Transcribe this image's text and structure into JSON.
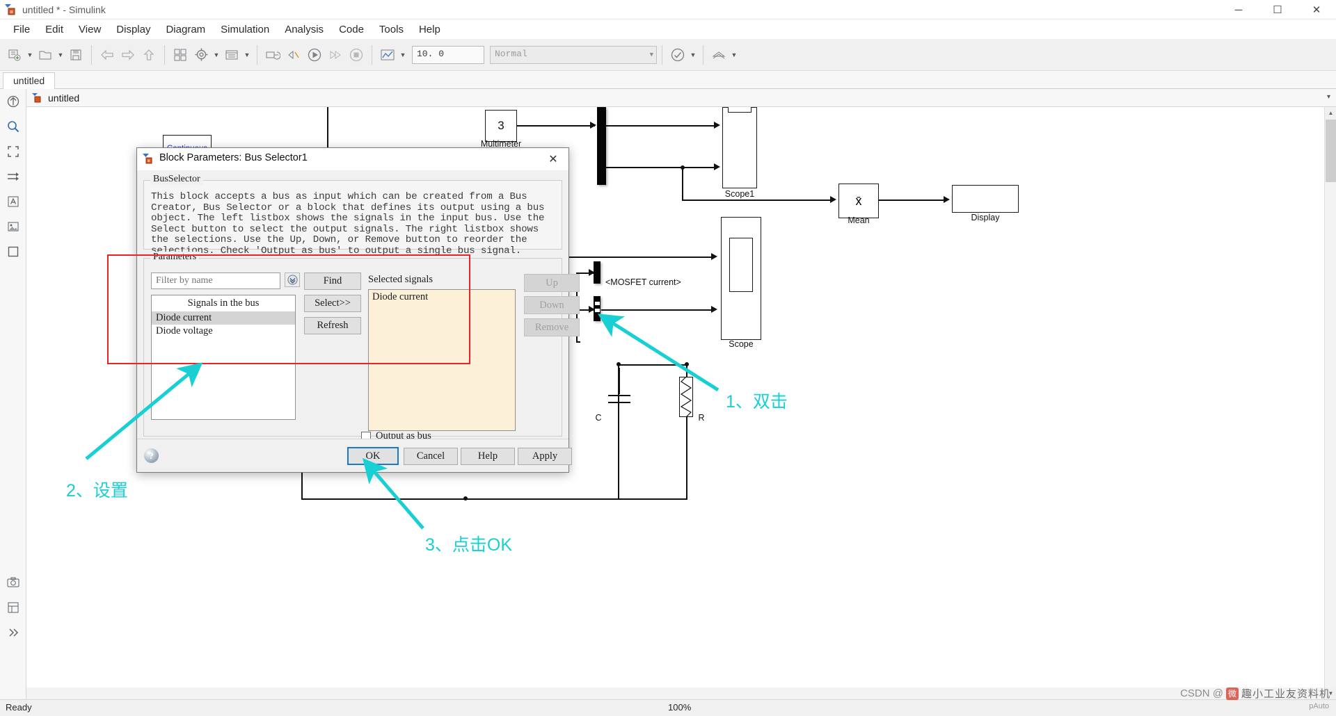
{
  "window": {
    "title": "untitled * - Simulink",
    "icon": "simulink-icon",
    "minimize": "─",
    "maximize": "☐",
    "close": "✕"
  },
  "menubar": {
    "items": [
      {
        "label": "File",
        "name": "menu-file"
      },
      {
        "label": "Edit",
        "name": "menu-edit"
      },
      {
        "label": "View",
        "name": "menu-view"
      },
      {
        "label": "Display",
        "name": "menu-display"
      },
      {
        "label": "Diagram",
        "name": "menu-diagram"
      },
      {
        "label": "Simulation",
        "name": "menu-simulation"
      },
      {
        "label": "Analysis",
        "name": "menu-analysis"
      },
      {
        "label": "Code",
        "name": "menu-code"
      },
      {
        "label": "Tools",
        "name": "menu-tools"
      },
      {
        "label": "Help",
        "name": "menu-help"
      }
    ]
  },
  "toolbar": {
    "stop_time": "10. 0",
    "sim_mode": "Normal"
  },
  "tabstrip": {
    "tab_label": "untitled"
  },
  "breadcrumb": {
    "label": "untitled"
  },
  "statusbar": {
    "status": "Ready",
    "zoom": "100%"
  },
  "canvas": {
    "blocks": [
      {
        "name": "continuous-block",
        "label": "Continuous"
      },
      {
        "name": "multimeter-block",
        "label": "Multimeter",
        "value": "3"
      },
      {
        "name": "scope1-block",
        "label": "Scope1"
      },
      {
        "name": "scope-block",
        "label": "Scope"
      },
      {
        "name": "mean-block",
        "label": "Mean",
        "symbol": "x̄"
      },
      {
        "name": "display-block",
        "label": "Display"
      },
      {
        "name": "capacitor",
        "label": "C"
      },
      {
        "name": "resistor",
        "label": "R"
      }
    ],
    "signal_labels": [
      {
        "name": "mosfet-current-label",
        "text": "<MOSFET current>"
      }
    ]
  },
  "dialog": {
    "title": "Block Parameters: Bus Selector1",
    "group_legend": "BusSelector",
    "description": "This block accepts a bus as input which can be created from a Bus Creator, Bus Selector or a block that defines its output using a bus object. The left listbox shows the signals in the input bus. Use the Select button to select the output signals. The right listbox shows the selections. Use the Up, Down, or Remove button to reorder the selections. Check 'Output as bus' to output a single bus signal.",
    "parameters_legend": "Parameters",
    "filter_placeholder": "Filter by name",
    "filter_value": "",
    "filter_icon": "filter-options-icon",
    "find_button": "Find",
    "select_button": "Select>>",
    "refresh_button": "Refresh",
    "signals_list_header": "Signals in the bus",
    "signals_list": [
      {
        "label": "Diode current",
        "selected": true
      },
      {
        "label": "Diode voltage",
        "selected": false
      }
    ],
    "selected_signals_label": "Selected signals",
    "selected_signals": [
      "Diode current"
    ],
    "up_button": "Up",
    "down_button": "Down",
    "remove_button": "Remove",
    "output_as_bus_label": "Output as bus",
    "output_as_bus_checked": false,
    "ok_button": "OK",
    "cancel_button": "Cancel",
    "help_button": "Help",
    "apply_button": "Apply",
    "help_icon": "?"
  },
  "annotations": {
    "step1": "1、双击",
    "step2": "2、设置",
    "step3": "3、点击OK",
    "accent_color": "#18cfd4",
    "highlight_color": "#ee2222"
  },
  "watermark": {
    "prefix": "CSDN @",
    "badge": "微",
    "text": "趣小工业友资料机",
    "sub": "pAuto"
  }
}
